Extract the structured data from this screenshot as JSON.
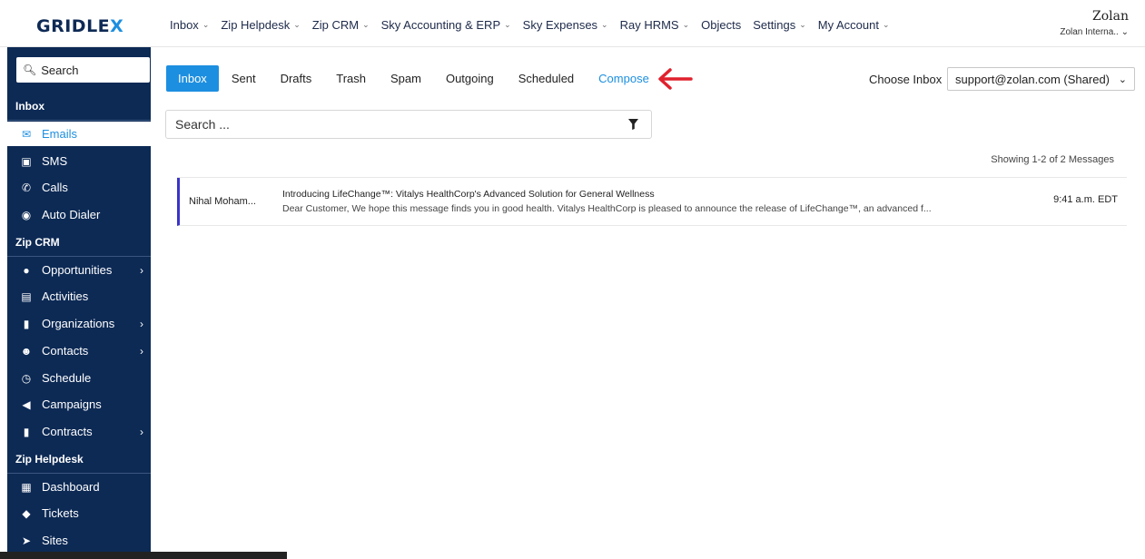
{
  "brand": {
    "logo_main": "GRIDLE",
    "logo_accent": "X"
  },
  "topnav": [
    {
      "label": "Inbox",
      "has_menu": true
    },
    {
      "label": "Zip Helpdesk",
      "has_menu": true
    },
    {
      "label": "Zip CRM",
      "has_menu": true
    },
    {
      "label": "Sky Accounting & ERP",
      "has_menu": true
    },
    {
      "label": "Sky Expenses",
      "has_menu": true
    },
    {
      "label": "Ray HRMS",
      "has_menu": true
    },
    {
      "label": "Objects",
      "has_menu": false
    },
    {
      "label": "Settings",
      "has_menu": true
    },
    {
      "label": "My Account",
      "has_menu": true
    }
  ],
  "account": {
    "name": "Zolan",
    "org": "Zolan Interna.."
  },
  "sidebar": {
    "search_label": "Search",
    "section_inbox": "Inbox",
    "inbox_items": [
      "Emails",
      "SMS",
      "Calls",
      "Auto Dialer"
    ],
    "section_crm": "Zip CRM",
    "crm_items": [
      "Opportunities",
      "Activities",
      "Organizations",
      "Contacts",
      "Schedule",
      "Campaigns",
      "Contracts"
    ],
    "section_helpdesk": "Zip Helpdesk",
    "helpdesk_items": [
      "Dashboard",
      "Tickets",
      "Sites"
    ]
  },
  "tabs": [
    "Inbox",
    "Sent",
    "Drafts",
    "Trash",
    "Spam",
    "Outgoing",
    "Scheduled",
    "Compose"
  ],
  "choose_inbox": {
    "label": "Choose Inbox",
    "value": "support@zolan.com (Shared)"
  },
  "search": {
    "placeholder": "Search ..."
  },
  "list": {
    "showing": "Showing 1-2 of 2 Messages",
    "messages": [
      {
        "from": "Nihal Moham...",
        "subject": "Introducing LifeChange™: Vitalys HealthCorp's Advanced Solution for General Wellness",
        "snippet": "Dear Customer, We hope this message finds you in good health. Vitalys HealthCorp is pleased to announce the release of LifeChange™, an advanced f...",
        "time": "9:41 a.m. EDT"
      }
    ]
  },
  "colors": {
    "accent": "#1d8fe0",
    "sidebar": "#0d2a55",
    "unread_marker": "#3a35c9",
    "annotation_arrow": "#e0212d"
  }
}
